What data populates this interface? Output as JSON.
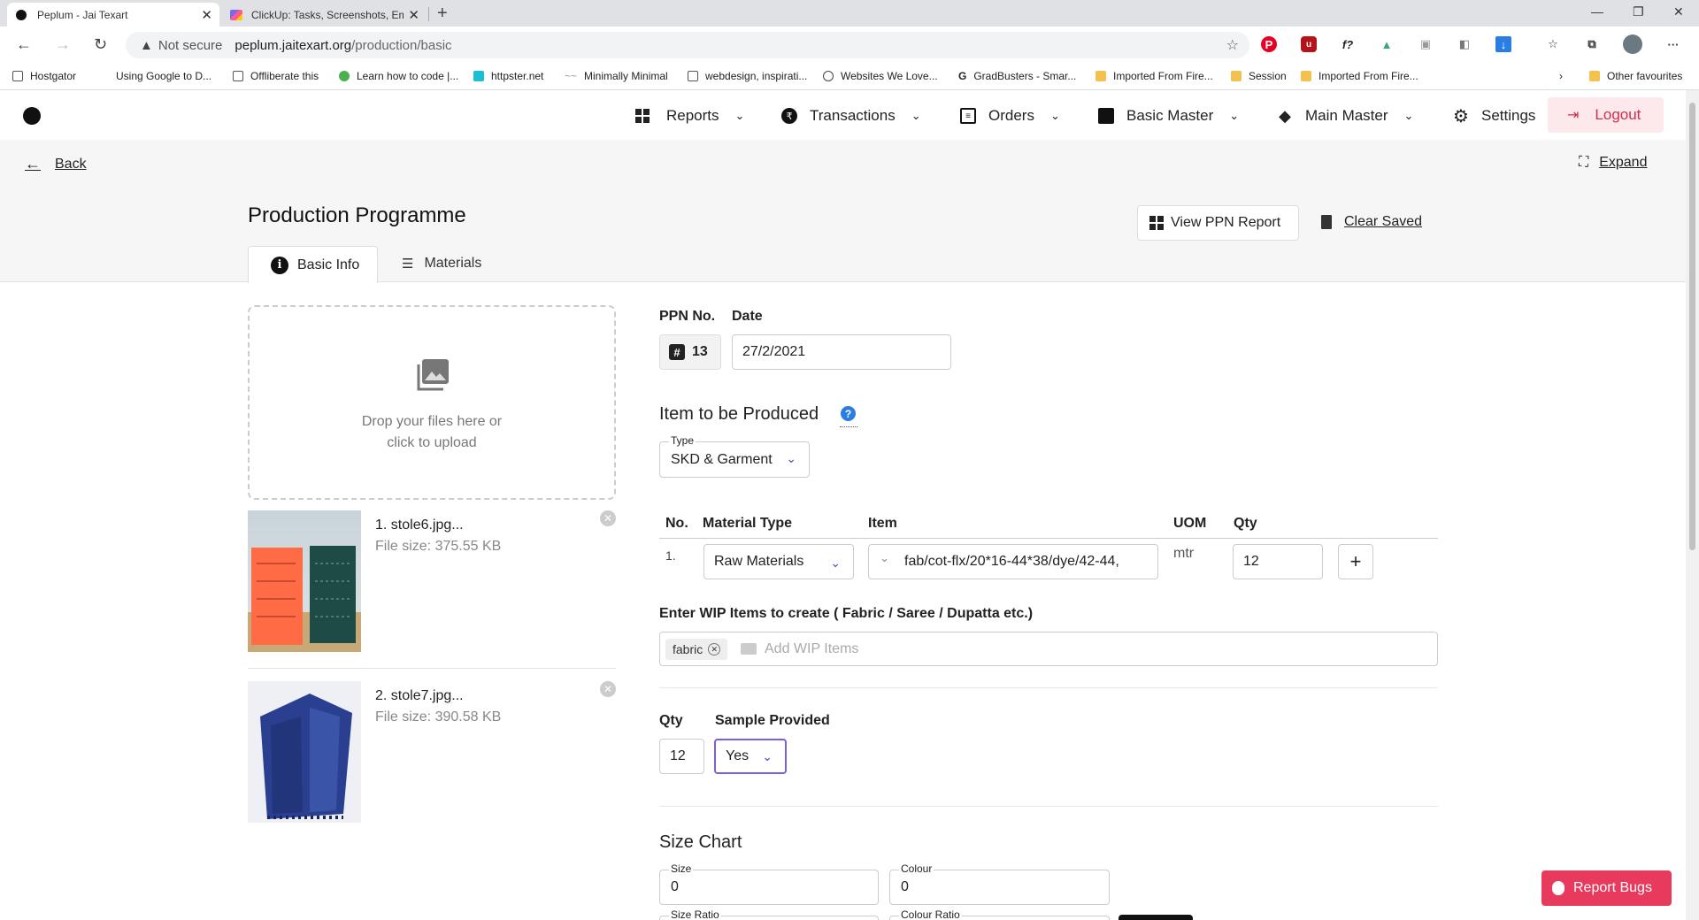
{
  "browser": {
    "tabs": [
      {
        "title": "Peplum - Jai Texart"
      },
      {
        "title": "ClickUp: Tasks, Screenshots, Ema"
      }
    ],
    "address": {
      "security": "Not secure",
      "host": "peplum.jaitexart.org",
      "path": "/production/basic"
    },
    "bookmarks": [
      {
        "label": "Hostgator",
        "icon": "page-icon"
      },
      {
        "label": "Using Google to D...",
        "icon": "none"
      },
      {
        "label": "Offliberate this",
        "icon": "page-icon"
      },
      {
        "label": "Learn how to code |...",
        "icon": "colorful-icon"
      },
      {
        "label": "httpster.net",
        "icon": "teal-icon"
      },
      {
        "label": "Minimally Minimal",
        "icon": "wave-icon"
      },
      {
        "label": "webdesign, inspirati...",
        "icon": "page-icon"
      },
      {
        "label": "Websites We Love...",
        "icon": "circle-icon"
      },
      {
        "label": "GradBusters - Smar...",
        "icon": "g-icon"
      },
      {
        "label": "Imported From Fire...",
        "icon": "folder-icon"
      },
      {
        "label": "Session",
        "icon": "folder-icon"
      },
      {
        "label": "Imported From Fire...",
        "icon": "folder-icon"
      }
    ],
    "other_bookmarks": "Other favourites"
  },
  "nav": {
    "items": [
      {
        "label": "Reports",
        "icon": "grid-icon"
      },
      {
        "label": "Transactions",
        "icon": "rupee-icon"
      },
      {
        "label": "Orders",
        "icon": "receipt-icon"
      },
      {
        "label": "Basic Master",
        "icon": "square-icon"
      },
      {
        "label": "Main Master",
        "icon": "layers-icon"
      }
    ],
    "settings": "Settings",
    "logout": "Logout"
  },
  "subheader": {
    "back": "Back",
    "expand": "Expand",
    "title": "Production Programme",
    "view_report": "View PPN Report",
    "clear_saved": "Clear Saved",
    "tabs": [
      "Basic Info",
      "Materials"
    ]
  },
  "upload": {
    "drop_text_1": "Drop your files here or",
    "drop_text_2": "click to upload",
    "files": [
      {
        "name": "1. stole6.jpg...",
        "size": "File size: 375.55 KB"
      },
      {
        "name": "2. stole7.jpg...",
        "size": "File size: 390.58 KB"
      }
    ]
  },
  "form": {
    "ppn_label": "PPN No.",
    "ppn_value": "13",
    "date_label": "Date",
    "date_value": "27/2/2021",
    "item_section": "Item to be Produced",
    "type_label": "Type",
    "type_value": "SKD & Garment",
    "table": {
      "headers": [
        "No.",
        "Material Type",
        "Item",
        "UOM",
        "Qty"
      ],
      "row": {
        "no": "1.",
        "material_type": "Raw Materials",
        "item": "fab/cot-flx/20*16-44*38/dye/42-44,",
        "uom": "mtr",
        "qty": "12"
      }
    },
    "wip_label": "Enter WIP Items to create ( Fabric / Saree / Dupatta etc.)",
    "wip_chip": "fabric",
    "wip_placeholder": "Add WIP Items",
    "qty_label": "Qty",
    "qty_value": "12",
    "sample_label": "Sample Provided",
    "sample_value": "Yes",
    "size_chart_title": "Size Chart",
    "size_label": "Size",
    "size_value": "0",
    "colour_label": "Colour",
    "colour_value": "0",
    "size_ratio_label": "Size Ratio",
    "colour_ratio_label": "Colour Ratio"
  },
  "report_bugs": "Report Bugs",
  "colors": {
    "accent": "#7b5fe0",
    "logout_bg": "#fde8ec",
    "logout_text": "#d22e4b",
    "report_bugs": "#e83a5c",
    "help": "#2a7de1"
  }
}
